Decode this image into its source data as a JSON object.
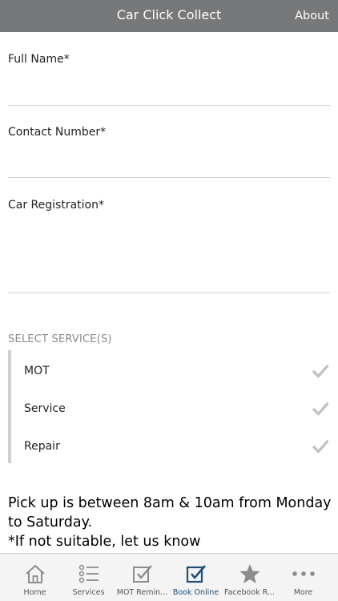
{
  "header": {
    "title": "Car Click Collect",
    "about_label": "About"
  },
  "form": {
    "full_name": {
      "label": "Full Name*",
      "value": ""
    },
    "contact_number": {
      "label": "Contact Number*",
      "value": ""
    },
    "car_registration": {
      "label": "Car Registration*",
      "value": ""
    }
  },
  "services": {
    "section_label": "SELECT SERVICE(S)",
    "items": [
      {
        "label": "MOT",
        "checked": false
      },
      {
        "label": "Service",
        "checked": false
      },
      {
        "label": "Repair",
        "checked": false
      }
    ]
  },
  "info": {
    "line1": "Pick up is between 8am & 10am from Monday to Saturday.",
    "line2": "*If not suitable, let us know"
  },
  "tabbar": {
    "items": [
      {
        "label": "Home",
        "icon": "home-icon"
      },
      {
        "label": "Services",
        "icon": "list-icon"
      },
      {
        "label": "MOT Remin...",
        "icon": "checkbox-icon"
      },
      {
        "label": "Book Online",
        "icon": "checkbox-icon",
        "active": true
      },
      {
        "label": "Facebook R...",
        "icon": "star-icon"
      },
      {
        "label": "More",
        "icon": "more-icon"
      }
    ]
  },
  "colors": {
    "header_bg": "#777879",
    "active_tab": "#1f4e78",
    "inactive_icon": "#8c8c8c",
    "check": "#c2c2c2"
  }
}
